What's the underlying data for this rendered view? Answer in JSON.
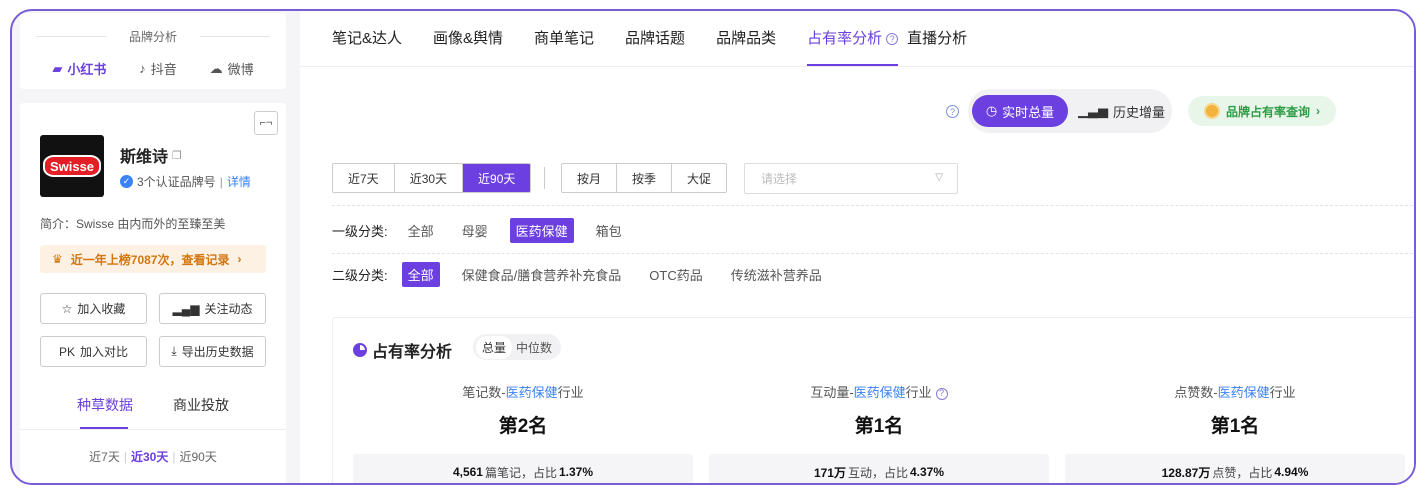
{
  "left": {
    "platform_title": "品牌分析",
    "platforms": [
      {
        "label": "小红书",
        "icon": "xiaohongshu-icon",
        "active": true
      },
      {
        "label": "抖音",
        "icon": "douyin-icon",
        "active": false
      },
      {
        "label": "微博",
        "icon": "weibo-icon",
        "active": false
      }
    ],
    "brand": {
      "logo_text": "Swisse",
      "name": "斯维诗",
      "cert_text": "3个认证品牌号",
      "cert_link": "详情",
      "intro": "简介：Swisse 由内而外的至臻至美",
      "rank_notice": "近一年上榜7087次，查看记录"
    },
    "buttons": {
      "favorite": "加入收藏",
      "follow": "关注动态",
      "compare": "加入对比",
      "export": "导出历史数据"
    },
    "tabs": [
      "种草数据",
      "商业投放"
    ],
    "periods": [
      "近7天",
      "近30天",
      "近90天"
    ]
  },
  "topnav": [
    "笔记&达人",
    "画像&舆情",
    "商单笔记",
    "品牌话题",
    "品牌品类",
    "占有率分析",
    "直播分析"
  ],
  "mode": {
    "realtime": "实时总量",
    "history": "历史增量",
    "query": "品牌占有率查询"
  },
  "filters": {
    "ranges": [
      "近7天",
      "近30天",
      "近90天"
    ],
    "granularity": [
      "按月",
      "按季",
      "大促"
    ],
    "select_placeholder": "请选择",
    "level1_label": "一级分类:",
    "level1": [
      "全部",
      "母婴",
      "医药保健",
      "箱包"
    ],
    "level2_label": "二级分类:",
    "level2": [
      "全部",
      "保健食品/膳食营养补充食品",
      "OTC药品",
      "传统滋补营养品"
    ]
  },
  "panel": {
    "title": "占有率分析",
    "toggle": [
      "总量",
      "中位数"
    ],
    "metrics": [
      {
        "title_a": "笔记数-",
        "title_hl": "医药保健",
        "title_b": "行业",
        "rank": "第2名",
        "value": "4,561",
        "unit": "篇笔记，占比",
        "pct": "1.37%",
        "help": false
      },
      {
        "title_a": "互动量-",
        "title_hl": "医药保健",
        "title_b": "行业",
        "rank": "第1名",
        "value": "171万",
        "unit": "互动，占比",
        "pct": "4.37%",
        "help": true
      },
      {
        "title_a": "点赞数-",
        "title_hl": "医药保健",
        "title_b": "行业",
        "rank": "第1名",
        "value": "128.87万",
        "unit": "点赞，占比",
        "pct": "4.94%",
        "help": false
      }
    ]
  }
}
